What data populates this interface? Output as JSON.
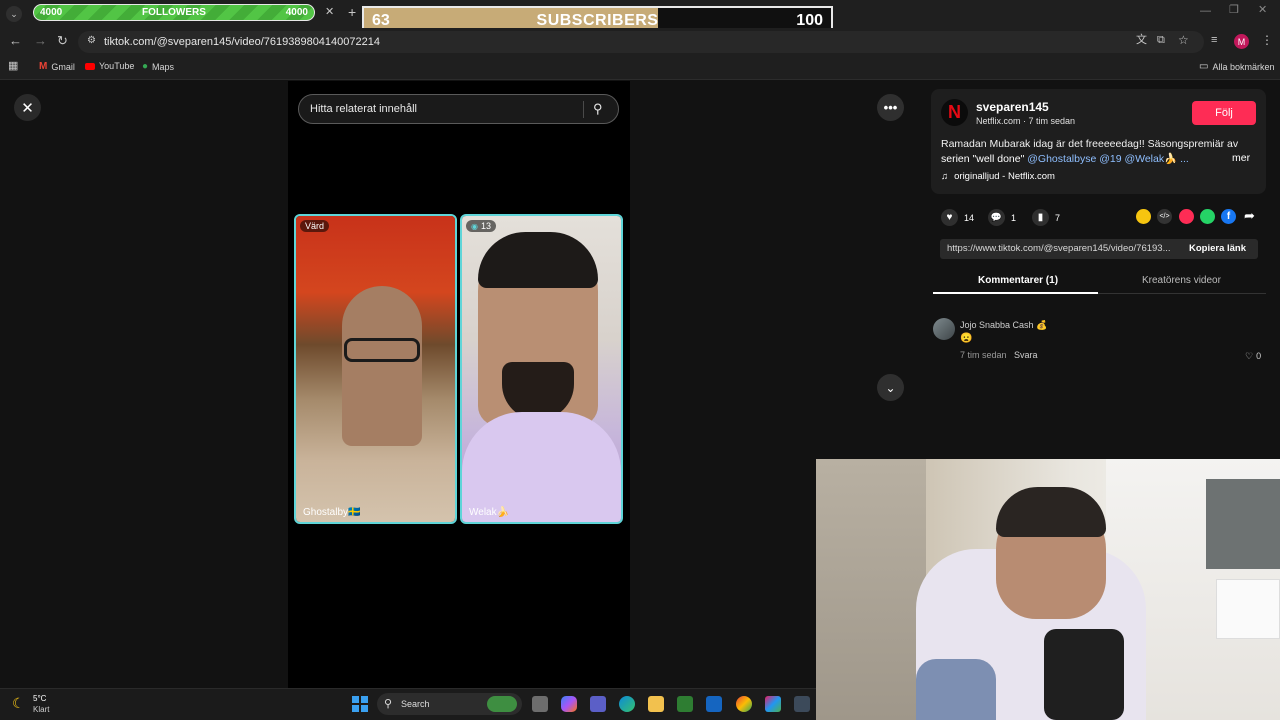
{
  "overlay": {
    "followers": {
      "left": "4000",
      "label": "FOLLOWERS",
      "right": "4000"
    },
    "subscribers": {
      "current": "63",
      "label": "SUBSCRIBERS",
      "goal": "100",
      "progress": 0.63
    }
  },
  "browser": {
    "url": "tiktok.com/@sveparen145/video/7619389804140072214",
    "bookmarks": [
      "Gmail",
      "YouTube",
      "Maps"
    ],
    "all_bookmarks": "Alla bokmärken",
    "profile_initial": "M"
  },
  "tiktok": {
    "search_placeholder": "Hitta relaterat innehåll",
    "tiles": [
      {
        "badge": "Värd",
        "name": "Ghostalby🇸🇪"
      },
      {
        "badge": "13",
        "name": "Welak🍌"
      }
    ],
    "author": {
      "username": "sveparen145",
      "subline": "Netflix.com · 7 tim sedan",
      "follow": "Följ",
      "caption_line1": "Ramadan Mubarak idag är det freeeeedag!! Säsongspremiär av",
      "caption_line2_prefix": "serien \"well done\"",
      "caption_mentions": "@Ghostalbyse @19 @Welak🍌 ...",
      "more": "mer",
      "sound": "originalljud - Netflix.com"
    },
    "stats": {
      "likes": "14",
      "comments": "1",
      "saves": "7"
    },
    "link": {
      "url": "https://www.tiktok.com/@sveparen145/video/76193...",
      "copy": "Kopiera länk"
    },
    "tabs": {
      "comments": "Kommentarer (1)",
      "creator_videos": "Kreatörens videor"
    },
    "comment": {
      "user": "Jojo Snabba Cash 💰",
      "text": "😦",
      "time": "7 tim sedan",
      "reply": "Svara",
      "likes": "0"
    }
  },
  "taskbar": {
    "weather_temp": "5°C",
    "weather_desc": "Klart",
    "search": "Search"
  },
  "colors": {
    "accent": "#fe2c55",
    "followers_green": "#52c545",
    "subs_gold": "#c7ab77",
    "tile_border": "#5fd5d8"
  }
}
